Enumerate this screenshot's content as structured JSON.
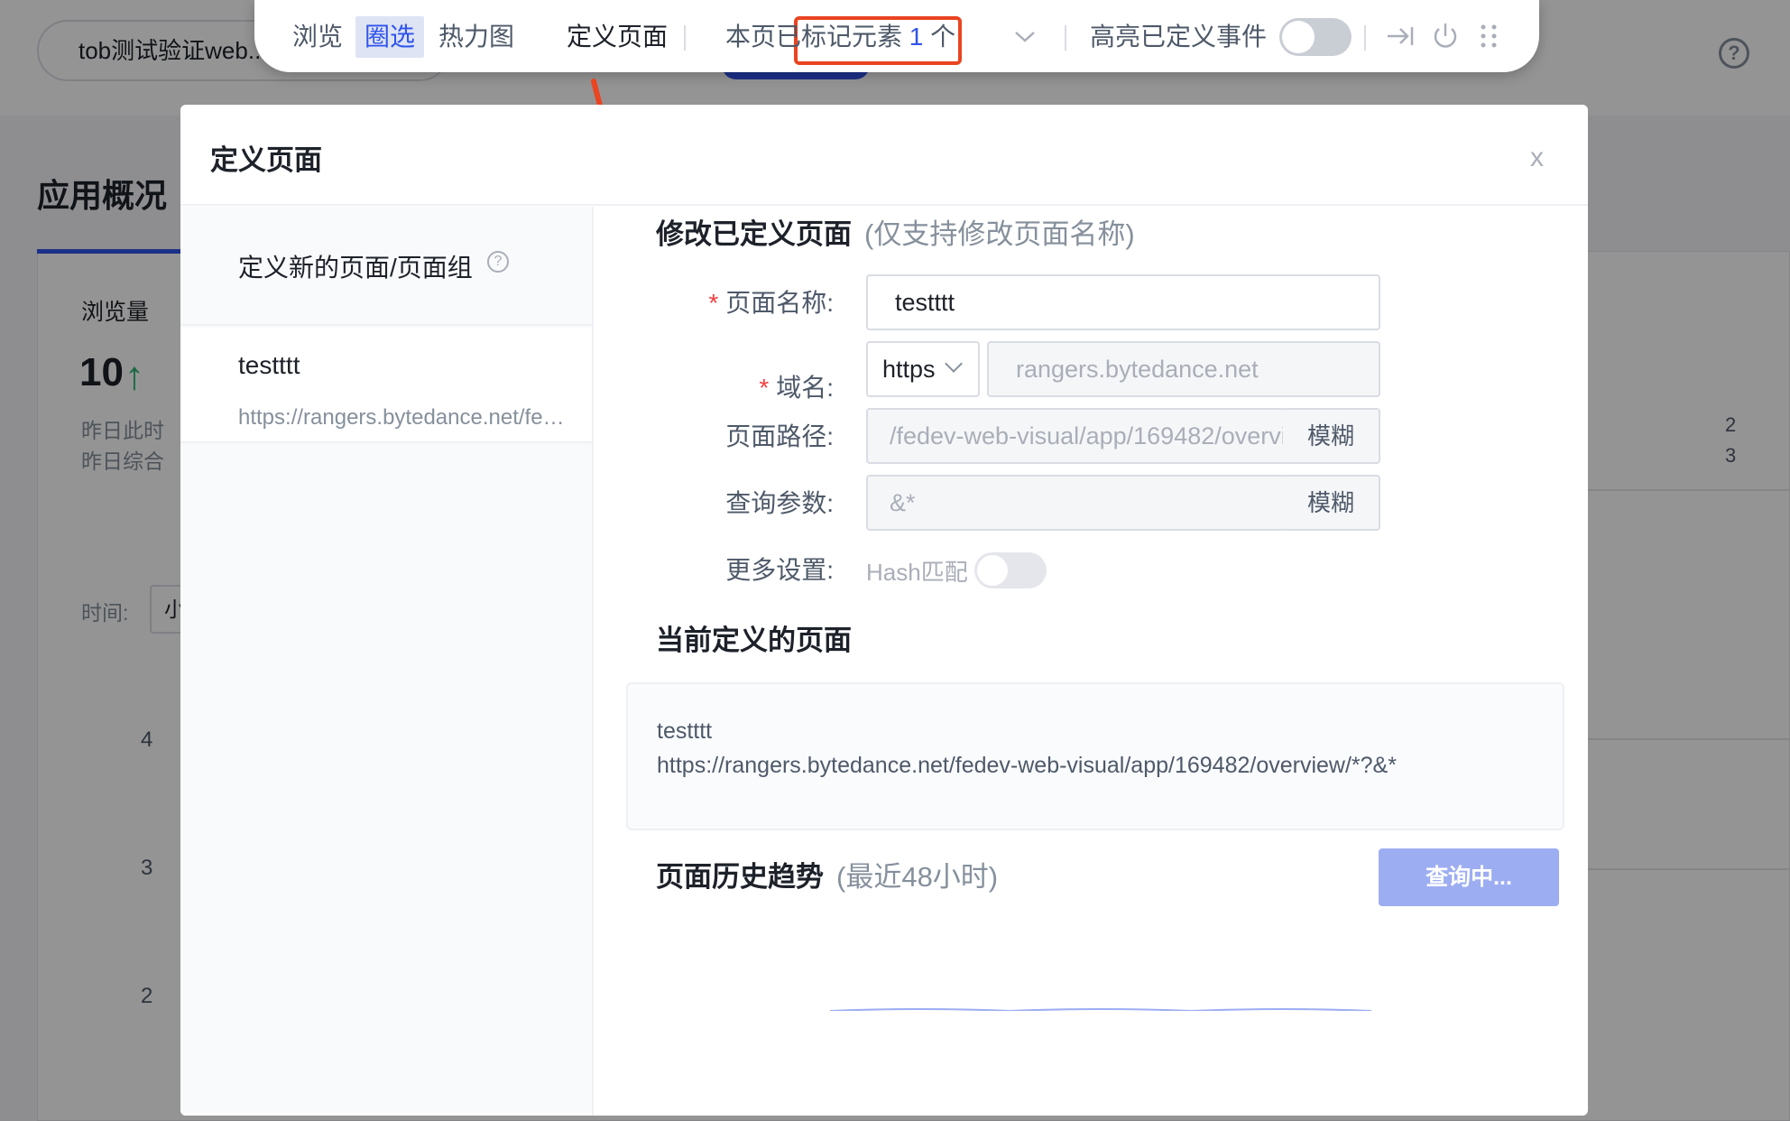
{
  "background": {
    "app_name": "tob测试验证web...",
    "page_title": "应用概况",
    "metric": {
      "label": "浏览量",
      "value": "10",
      "yesterday_now": "昨日此时",
      "yesterday_total": "昨日综合"
    },
    "time_label": "时间:",
    "time_value": "小",
    "y_ticks": [
      "4",
      "3",
      "2"
    ],
    "right_values": [
      "2",
      "3"
    ],
    "help_icon_text": "?"
  },
  "toolbar": {
    "browse": "浏览",
    "circle_select": "圈选",
    "heatmap": "热力图",
    "define_page": "定义页面",
    "marked_prefix": "本页已标记元素",
    "marked_count": "1",
    "marked_suffix": "个",
    "highlight_events": "高亮已定义事件",
    "highlight_enabled": false,
    "icons": [
      "chevron-down-icon",
      "collapse-right-icon",
      "power-icon",
      "drag-handle-icon"
    ]
  },
  "modal": {
    "title": "定义页面",
    "close_label": "x",
    "left": {
      "new_label": "定义新的页面/页面组",
      "new_help_icon": "?",
      "items": [
        {
          "name": "testttt",
          "url": "https://rangers.bytedance.net/fedev-web-visual/app/169482/overview/*"
        }
      ]
    },
    "edit": {
      "title": "修改已定义页面",
      "note": "(仅支持修改页面名称)",
      "page_name_label": "页面名称:",
      "page_name_value": "testttt",
      "required_mark": "*",
      "domain_label": "域名:",
      "protocol_value": "https",
      "domain_value": "rangers.bytedance.net",
      "path_label": "页面路径:",
      "path_value": "/fedev-web-visual/app/169482/overview/*",
      "path_mode": "模糊",
      "query_label": "查询参数:",
      "query_value": "&*",
      "query_mode": "模糊",
      "more_label": "更多设置:",
      "hash_label": "Hash匹配",
      "hash_enabled": false
    },
    "current": {
      "title": "当前定义的页面",
      "name": "testttt",
      "url": "https://rangers.bytedance.net/fedev-web-visual/app/169482/overview/*?&*"
    },
    "history": {
      "title": "页面历史趋势",
      "note": "(最近48小时)",
      "query_button": "查询中..."
    }
  },
  "colors": {
    "accent": "#2f54eb",
    "annotation_red": "#ea4420",
    "required_red": "#f53f3f",
    "trend_green": "#2bb673"
  }
}
